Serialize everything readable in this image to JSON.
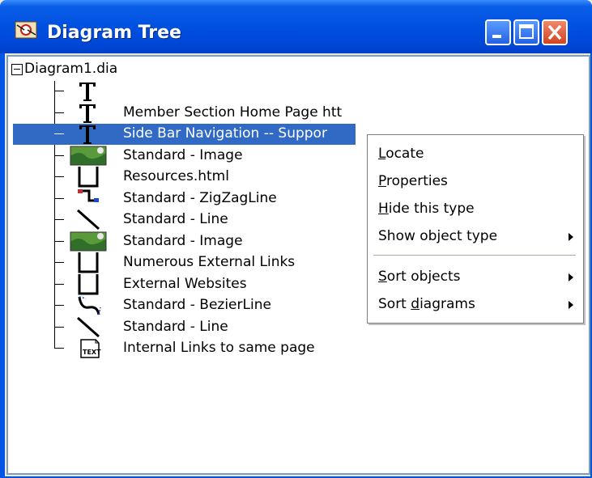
{
  "window": {
    "title": "Diagram Tree"
  },
  "tree": {
    "root": "Diagram1.dia",
    "items": [
      {
        "label": "",
        "icon": "text-icon"
      },
      {
        "label": "Member Section Home Page  htt",
        "icon": "text-icon"
      },
      {
        "label": "Side Bar Navigation -- Suppor",
        "icon": "text-icon",
        "selected": true
      },
      {
        "label": "Standard - Image",
        "icon": "image-icon"
      },
      {
        "label": "Resources.html",
        "icon": "box-icon"
      },
      {
        "label": "Standard - ZigZagLine",
        "icon": "zigzagline-icon"
      },
      {
        "label": "Standard - Line",
        "icon": "line-icon"
      },
      {
        "label": "Standard - Image",
        "icon": "image-icon"
      },
      {
        "label": "Numerous External Links",
        "icon": "box-icon"
      },
      {
        "label": "External Websites",
        "icon": "box-icon"
      },
      {
        "label": "Standard - BezierLine",
        "icon": "bezierline-icon"
      },
      {
        "label": "Standard - Line",
        "icon": "line-icon"
      },
      {
        "label": "Internal Links to same page",
        "icon": "textbox-icon"
      }
    ]
  },
  "context_menu": {
    "items": [
      {
        "label": "Locate",
        "accel": "L",
        "submenu": false
      },
      {
        "label": "Properties",
        "accel": "P",
        "submenu": false
      },
      {
        "label": "Hide this type",
        "accel": "H",
        "submenu": false
      },
      {
        "label": "Show object type",
        "accel": "",
        "submenu": true
      },
      {
        "label": "Sort objects",
        "accel": "S",
        "submenu": true
      },
      {
        "label": "Sort diagrams",
        "accel": "d",
        "submenu": true
      }
    ]
  },
  "colors": {
    "titlebar": "#0050e0",
    "selection": "#316ac5",
    "tree_border": "#7f9db9"
  }
}
